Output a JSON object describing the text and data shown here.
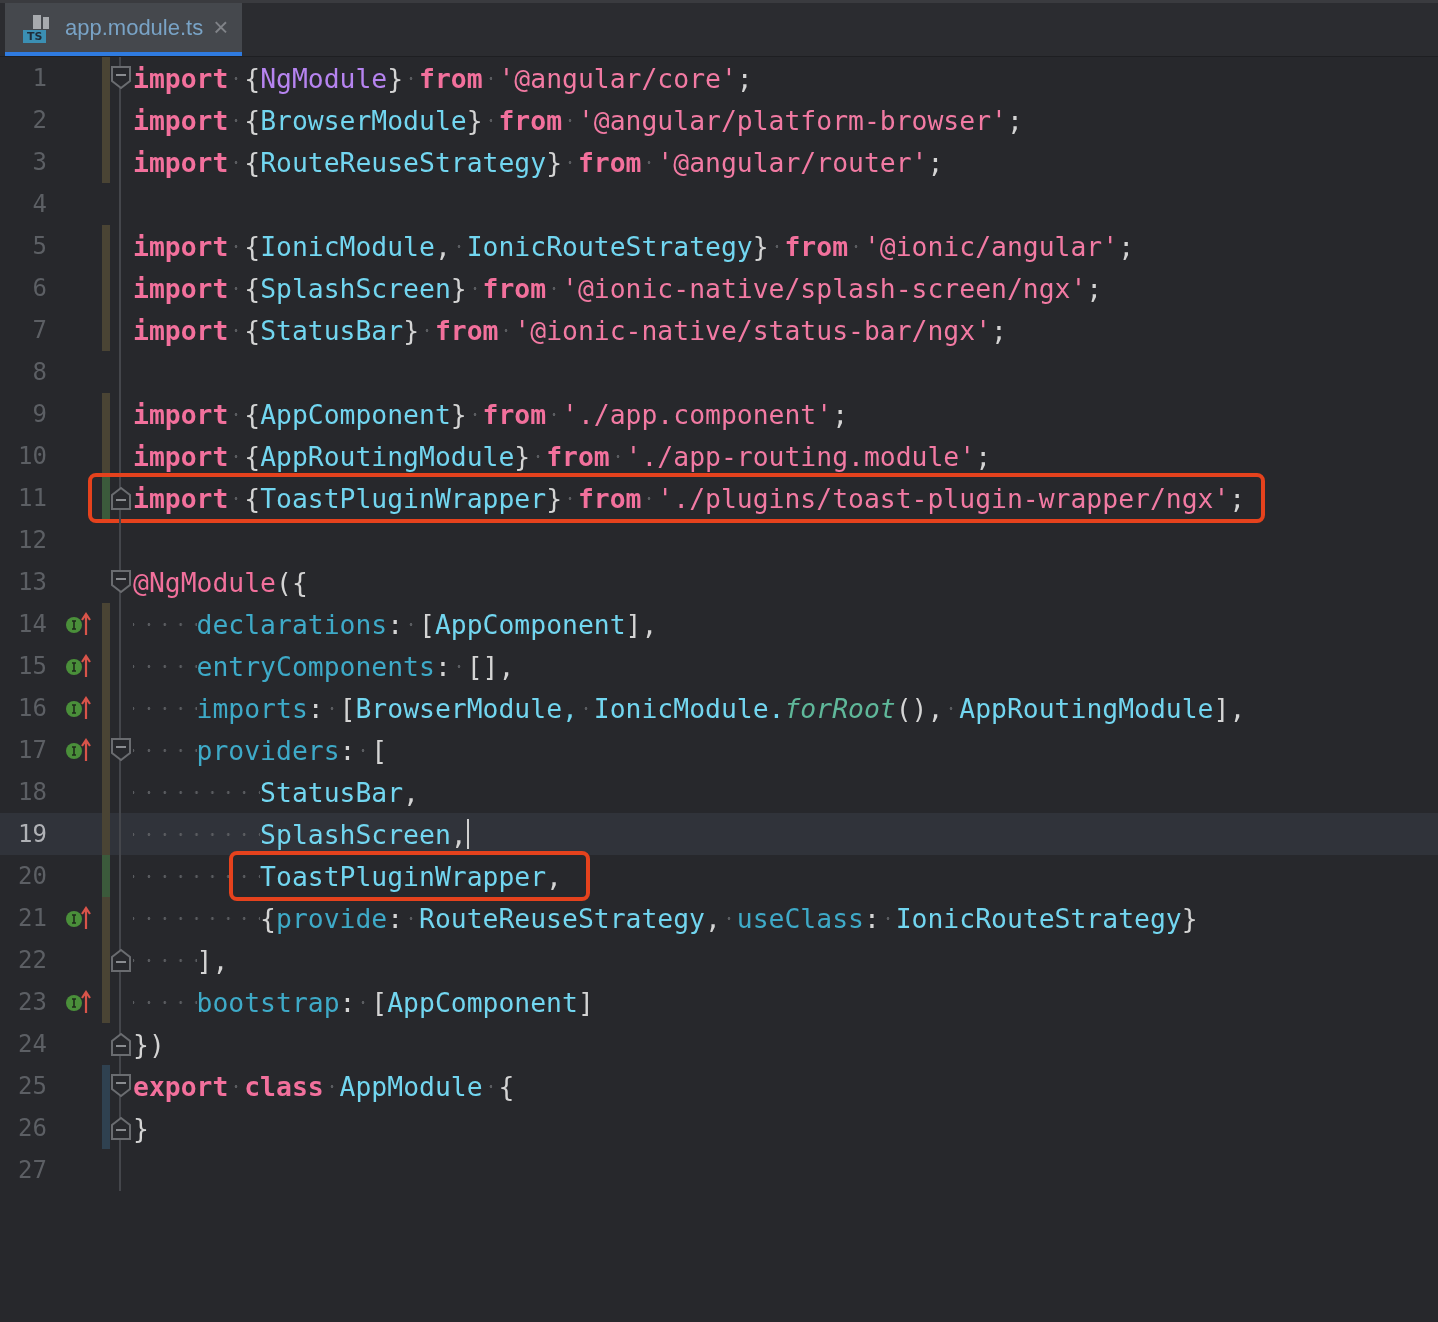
{
  "tab": {
    "icon_label": "TS",
    "title": "app.module.ts",
    "close": "×",
    "selected": true
  },
  "lines": [
    {
      "number": "1",
      "current": false,
      "fold_start": true,
      "color": "#4a4434",
      "tokens": [
        {
          "kind": "kw",
          "text": "import"
        },
        {
          "kind": "punc",
          "text": " {"
        },
        {
          "kind": "type",
          "text": "NgModule"
        },
        {
          "kind": "punc",
          "text": "} "
        },
        {
          "kind": "kw",
          "text": "from"
        },
        {
          "kind": "str",
          "text": " '@angular/core'"
        },
        {
          "kind": "punc",
          "text": ";"
        }
      ]
    },
    {
      "number": "2",
      "current": false,
      "color": "#4a4434",
      "tokens": [
        {
          "kind": "kw",
          "text": "import"
        },
        {
          "kind": "punc",
          "text": " {"
        },
        {
          "kind": "name",
          "text": "BrowserModule"
        },
        {
          "kind": "punc",
          "text": "} "
        },
        {
          "kind": "kw",
          "text": "from"
        },
        {
          "kind": "str",
          "text": " '@angular/platform-browser'"
        },
        {
          "kind": "punc",
          "text": ";"
        }
      ]
    },
    {
      "number": "3",
      "current": false,
      "color": "#4a4434",
      "tokens": [
        {
          "kind": "kw",
          "text": "import"
        },
        {
          "kind": "punc",
          "text": " {"
        },
        {
          "kind": "name",
          "text": "RouteReuseStrategy"
        },
        {
          "kind": "punc",
          "text": "} "
        },
        {
          "kind": "kw",
          "text": "from"
        },
        {
          "kind": "str",
          "text": " '@angular/router'"
        },
        {
          "kind": "punc",
          "text": ";"
        }
      ]
    },
    {
      "number": "4",
      "current": false
    },
    {
      "number": "5",
      "current": false,
      "color": "#4a4434",
      "tokens": [
        {
          "kind": "kw",
          "text": "import"
        },
        {
          "kind": "punc",
          "text": " {"
        },
        {
          "kind": "name",
          "text": "IonicModule"
        },
        {
          "kind": "punc",
          "text": ", "
        },
        {
          "kind": "name",
          "text": "IonicRouteStrategy"
        },
        {
          "kind": "punc",
          "text": "} "
        },
        {
          "kind": "kw",
          "text": "from"
        },
        {
          "kind": "str",
          "text": " '@ionic/angular'"
        },
        {
          "kind": "punc",
          "text": ";"
        }
      ]
    },
    {
      "number": "6",
      "current": false,
      "color": "#4a4434",
      "tokens": [
        {
          "kind": "kw",
          "text": "import"
        },
        {
          "kind": "punc",
          "text": " {"
        },
        {
          "kind": "name",
          "text": "SplashScreen"
        },
        {
          "kind": "punc",
          "text": "} "
        },
        {
          "kind": "kw",
          "text": "from"
        },
        {
          "kind": "str",
          "text": " '@ionic-native/splash-screen/ngx'"
        },
        {
          "kind": "punc",
          "text": ";"
        }
      ]
    },
    {
      "number": "7",
      "current": false,
      "color": "#4a4434",
      "tokens": [
        {
          "kind": "kw",
          "text": "import"
        },
        {
          "kind": "punc",
          "text": " {"
        },
        {
          "kind": "name",
          "text": "StatusBar"
        },
        {
          "kind": "punc",
          "text": "} "
        },
        {
          "kind": "kw",
          "text": "from"
        },
        {
          "kind": "str",
          "text": " '@ionic-native/status-bar/ngx'"
        },
        {
          "kind": "punc",
          "text": ";"
        }
      ]
    },
    {
      "number": "8",
      "current": false
    },
    {
      "number": "9",
      "current": false,
      "color": "#4a4434",
      "tokens": [
        {
          "kind": "kw",
          "text": "import"
        },
        {
          "kind": "punc",
          "text": " {"
        },
        {
          "kind": "name",
          "text": "AppComponent"
        },
        {
          "kind": "punc",
          "text": "} "
        },
        {
          "kind": "kw",
          "text": "from"
        },
        {
          "kind": "str",
          "text": " './app.component'"
        },
        {
          "kind": "punc",
          "text": ";"
        }
      ]
    },
    {
      "number": "10",
      "current": false,
      "color": "#4a4434",
      "tokens": [
        {
          "kind": "kw",
          "text": "import"
        },
        {
          "kind": "punc",
          "text": " {"
        },
        {
          "kind": "name",
          "text": "AppRoutingModule"
        },
        {
          "kind": "punc",
          "text": "} "
        },
        {
          "kind": "kw",
          "text": "from"
        },
        {
          "kind": "str",
          "text": " './app-routing.module'"
        },
        {
          "kind": "punc",
          "text": ";"
        }
      ]
    },
    {
      "number": "11",
      "current": false,
      "fold_end": true,
      "color": "#3b5a3b",
      "line_boxed": true,
      "tokens": [
        {
          "kind": "kw",
          "text": "import"
        },
        {
          "kind": "punc",
          "text": " {"
        },
        {
          "kind": "name",
          "text": "ToastPluginWrapper"
        },
        {
          "kind": "punc",
          "text": "} "
        },
        {
          "kind": "kw",
          "text": "from"
        },
        {
          "kind": "str",
          "text": " './plugins/toast-plugin-wrapper/ngx'"
        },
        {
          "kind": "punc",
          "text": ";"
        }
      ]
    },
    {
      "number": "12",
      "current": false
    },
    {
      "number": "13",
      "current": false,
      "fold_start": true,
      "tokens": [
        {
          "kind": "deco",
          "text": "@NgModule"
        },
        {
          "kind": "punc",
          "text": "({"
        }
      ]
    },
    {
      "number": "14",
      "current": false,
      "implements": true,
      "color": "#4a4434",
      "tokens": [
        {
          "kind": "prop",
          "text": "    declarations"
        },
        {
          "kind": "punc",
          "text": ": ["
        },
        {
          "kind": "name",
          "text": "AppComponent"
        },
        {
          "kind": "punc",
          "text": "],"
        }
      ]
    },
    {
      "number": "15",
      "current": false,
      "implements": true,
      "color": "#4a4434",
      "tokens": [
        {
          "kind": "prop",
          "text": "    entryComponents"
        },
        {
          "kind": "punc",
          "text": ": [],"
        }
      ]
    },
    {
      "number": "16",
      "current": false,
      "implements": true,
      "color": "#4a4434",
      "tokens": [
        {
          "kind": "prop",
          "text": "    imports"
        },
        {
          "kind": "punc",
          "text": ": ["
        },
        {
          "kind": "name",
          "text": "BrowserModule, IonicModule."
        },
        {
          "kind": "method",
          "text": "forRoot"
        },
        {
          "kind": "punc",
          "text": "(), "
        },
        {
          "kind": "name",
          "text": "AppRoutingModule"
        },
        {
          "kind": "punc",
          "text": "],"
        }
      ]
    },
    {
      "number": "17",
      "current": false,
      "implements": true,
      "fold_start": true,
      "color": "#4a4434",
      "tokens": [
        {
          "kind": "prop",
          "text": "    providers"
        },
        {
          "kind": "punc",
          "text": ": ["
        }
      ]
    },
    {
      "number": "18",
      "current": false,
      "color": "#4a4434",
      "tokens": [
        {
          "kind": "name",
          "text": "        StatusBar"
        },
        {
          "kind": "punc",
          "text": ","
        }
      ]
    },
    {
      "number": "19",
      "current": true,
      "color": "#4a4434",
      "tokens": [
        {
          "kind": "name",
          "text": "        SplashScreen"
        },
        {
          "kind": "punc",
          "text": ","
        }
      ]
    },
    {
      "number": "20",
      "current": false,
      "color": "#3b5a3b",
      "code_boxed": true,
      "tokens": [
        {
          "kind": "name",
          "text": "        ToastPluginWrapper"
        },
        {
          "kind": "punc",
          "text": ","
        }
      ]
    },
    {
      "number": "21",
      "current": false,
      "implements": true,
      "color": "#4a4434",
      "tokens": [
        {
          "kind": "punc",
          "text": "        {"
        },
        {
          "kind": "prop",
          "text": "provide"
        },
        {
          "kind": "punc",
          "text": ": "
        },
        {
          "kind": "name",
          "text": "RouteReuseStrategy"
        },
        {
          "kind": "punc",
          "text": ", "
        },
        {
          "kind": "prop",
          "text": "useClass"
        },
        {
          "kind": "punc",
          "text": ": "
        },
        {
          "kind": "name",
          "text": "IonicRouteStrategy"
        },
        {
          "kind": "punc",
          "text": "}"
        }
      ]
    },
    {
      "number": "22",
      "current": false,
      "fold_end": true,
      "color": "#4a4434",
      "tokens": [
        {
          "kind": "punc",
          "text": "    ],"
        }
      ]
    },
    {
      "number": "23",
      "current": false,
      "implements": true,
      "color": "#4a4434",
      "tokens": [
        {
          "kind": "prop",
          "text": "    bootstrap"
        },
        {
          "kind": "punc",
          "text": ": ["
        },
        {
          "kind": "name",
          "text": "AppComponent"
        },
        {
          "kind": "punc",
          "text": "]"
        }
      ]
    },
    {
      "number": "24",
      "current": false,
      "fold_end": true,
      "tokens": [
        {
          "kind": "punc",
          "text": "})"
        }
      ]
    },
    {
      "number": "25",
      "current": false,
      "fold_start": true,
      "color": "#2f4150",
      "tokens": [
        {
          "kind": "kw",
          "text": "export"
        },
        {
          "kind": "kw",
          "text": " class"
        },
        {
          "kind": "name",
          "text": " AppModule"
        },
        {
          "kind": "punc",
          "text": " {"
        }
      ]
    },
    {
      "number": "26",
      "current": false,
      "fold_end": true,
      "color": "#2f4150",
      "tokens": [
        {
          "kind": "punc",
          "text": "}"
        }
      ]
    },
    {
      "number": "27",
      "current": false
    }
  ]
}
